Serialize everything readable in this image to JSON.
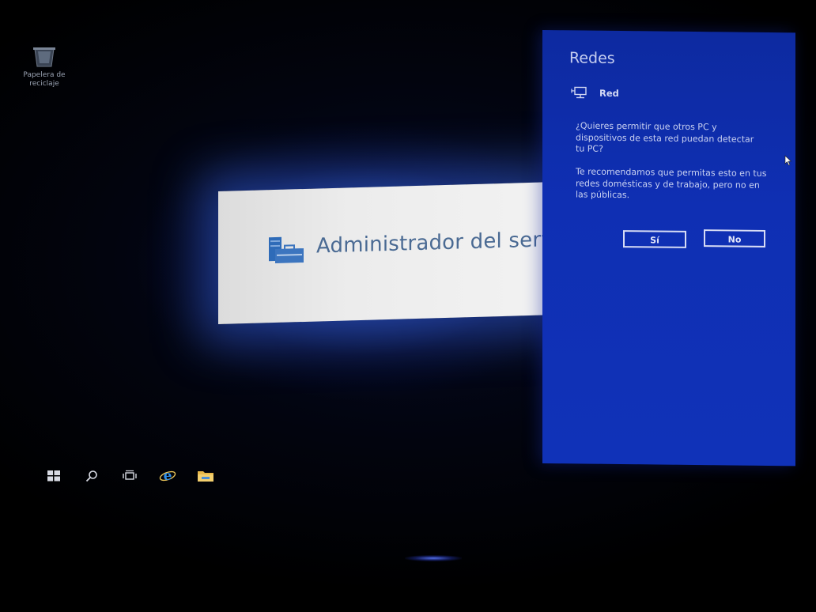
{
  "desktop": {
    "recycle_bin_label": "Papelera de reciclaje",
    "recycle_bin_icon": "recycle-bin-icon"
  },
  "splash": {
    "title": "Administrador del servic",
    "logo_icon": "server-manager-icon"
  },
  "networks_flyout": {
    "title": "Redes",
    "network_icon": "wired-network-icon",
    "network_name": "Red",
    "question": "¿Quieres permitir que otros PC y dispositivos de esta red puedan detectar tu PC?",
    "recommendation": "Te recomendamos que permitas esto en tus redes domésticas y de trabajo, pero no en las públicas.",
    "yes_label": "Sí",
    "no_label": "No"
  },
  "taskbar": {
    "items": [
      {
        "icon": "windows-start-icon"
      },
      {
        "icon": "search-icon"
      },
      {
        "icon": "task-view-icon"
      },
      {
        "icon": "internet-explorer-icon"
      },
      {
        "icon": "file-explorer-icon"
      }
    ]
  },
  "colors": {
    "flyout_bg": "#1032b8",
    "flyout_text": "#c9d1f1",
    "splash_title": "#4a6a93",
    "ie_blue": "#1e88e5",
    "explorer_yellow": "#e8b84a"
  }
}
